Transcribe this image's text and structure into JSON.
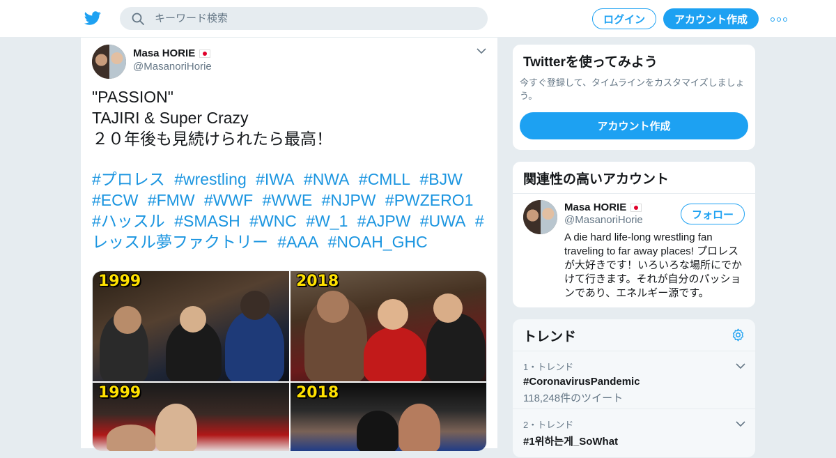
{
  "header": {
    "search_placeholder": "キーワード検索",
    "login_label": "ログイン",
    "signup_label": "アカウント作成"
  },
  "tweet": {
    "author_name": "Masa HORIE",
    "author_handle": "@MasanoriHorie",
    "text": "\"PASSION\"\nTAJIRI & Super Crazy\n２０年後も見続けられたら最高！",
    "hashtags": [
      "#プロレス",
      "#wrestling",
      "#IWA",
      "#NWA",
      "#CMLL",
      "#BJW",
      "#ECW",
      "#FMW",
      "#WWF",
      "#WWE",
      "#NJPW",
      "#PWZERO1",
      "#ハッスル",
      "#SMASH",
      "#WNC",
      "#W_1",
      "#AJPW",
      "#UWA",
      "#レッスル夢ファクトリー",
      "#AAA",
      "#NOAH_GHC"
    ],
    "media_years": [
      "1999",
      "2018",
      "1999",
      "2018"
    ]
  },
  "signup_card": {
    "title": "Twitterを使ってみよう",
    "subtitle": "今すぐ登録して、タイムラインをカスタマイズしましょう。",
    "button_label": "アカウント作成"
  },
  "related_card": {
    "title": "関連性の高いアカウント",
    "name": "Masa HORIE",
    "handle": "@MasanoriHorie",
    "follow_label": "フォロー",
    "bio": "A die hard life-long wrestling fan traveling to far away places! プロレスが大好きです！いろいろな場所にでかけて行きます。それが自分のパッションであり、エネルギー源です。"
  },
  "trends": {
    "title": "トレンド",
    "items": [
      {
        "meta": "1・トレンド",
        "title": "#CoronavirusPandemic",
        "count": "118,248件のツイート"
      },
      {
        "meta": "2・トレンド",
        "title": "#1위하는게_SoWhat",
        "count": ""
      }
    ]
  },
  "colors": {
    "accent": "#1da1f2",
    "hashtag": "#1b95e0",
    "background": "#e6ecf0"
  }
}
